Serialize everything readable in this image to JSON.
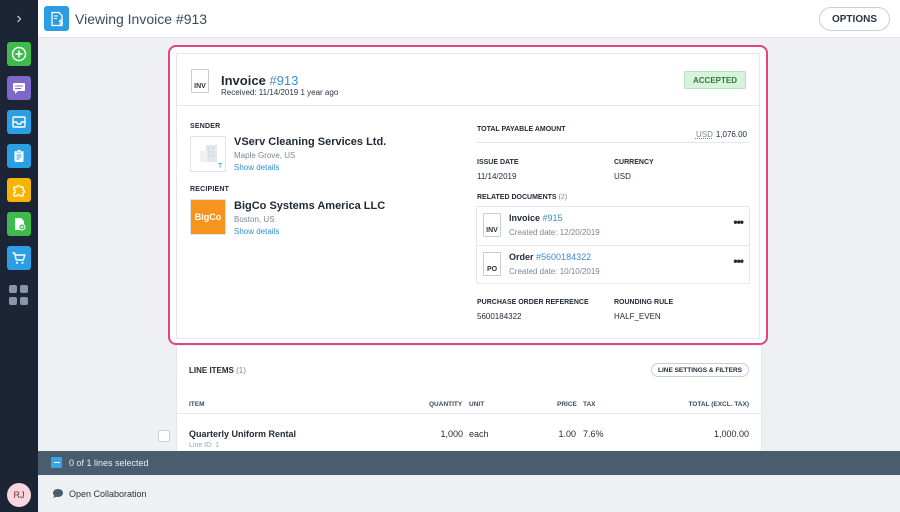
{
  "header": {
    "title": "Viewing Invoice #913",
    "options_label": "OPTIONS"
  },
  "sidebar": {
    "items": [
      {
        "icon": "plus-circle-icon",
        "color": "#3dbb4c"
      },
      {
        "icon": "chat-icon",
        "color": "#7b68c9"
      },
      {
        "icon": "inbox-icon",
        "color": "#2a9fe4"
      },
      {
        "icon": "clipboard-icon",
        "color": "#2a9fe4"
      },
      {
        "icon": "puzzle-icon",
        "color": "#f4b400"
      },
      {
        "icon": "document-add-icon",
        "color": "#3dbb4c"
      },
      {
        "icon": "cart-icon",
        "color": "#2a9fe4"
      }
    ],
    "avatar_initials": "RJ"
  },
  "invoice": {
    "doc_type": "INV",
    "title_label": "Invoice",
    "number": "#913",
    "received": "Received: 11/14/2019 1 year ago",
    "status": "ACCEPTED"
  },
  "sender": {
    "label": "SENDER",
    "name": "VServ Cleaning Services Ltd.",
    "location": "Maple Grove, US",
    "details_link": "Show details"
  },
  "recipient": {
    "label": "RECIPIENT",
    "name": "BigCo Systems America LLC",
    "location": "Boston, US",
    "details_link": "Show details",
    "logo_text": "BigCo"
  },
  "totals": {
    "label": "TOTAL PAYABLE AMOUNT",
    "currency_code": "USD",
    "amount": "1,076.00"
  },
  "fields": {
    "issue_date_label": "ISSUE DATE",
    "issue_date": "11/14/2019",
    "currency_label": "CURRENCY",
    "currency": "USD",
    "po_ref_label": "PURCHASE ORDER REFERENCE",
    "po_ref": "5600184322",
    "rounding_label": "ROUNDING RULE",
    "rounding": "HALF_EVEN"
  },
  "related": {
    "label": "RELATED DOCUMENTS",
    "count": "(2)",
    "docs": [
      {
        "type": "INV",
        "title": "Invoice",
        "number": "#915",
        "created": "Created date: 12/20/2019"
      },
      {
        "type": "PO",
        "title": "Order",
        "number": "#5600184322",
        "created": "Created date: 10/10/2019"
      }
    ]
  },
  "line_items": {
    "title": "LINE ITEMS",
    "count": "(1)",
    "settings_label": "LINE SETTINGS & FILTERS",
    "columns": {
      "item": "ITEM",
      "quantity": "QUANTITY",
      "unit": "UNIT",
      "price": "PRICE",
      "tax": "TAX",
      "total": "TOTAL (EXCL. TAX)"
    },
    "rows": [
      {
        "item": "Quarterly Uniform Rental",
        "line_id": "Line ID: 1",
        "quantity": "1,000",
        "unit": "each",
        "price": "1.00",
        "tax": "7.6%",
        "total": "1,000.00"
      }
    ]
  },
  "selection": {
    "text": "0 of 1 lines selected"
  },
  "footer": {
    "collab_label": "Open Collaboration"
  }
}
